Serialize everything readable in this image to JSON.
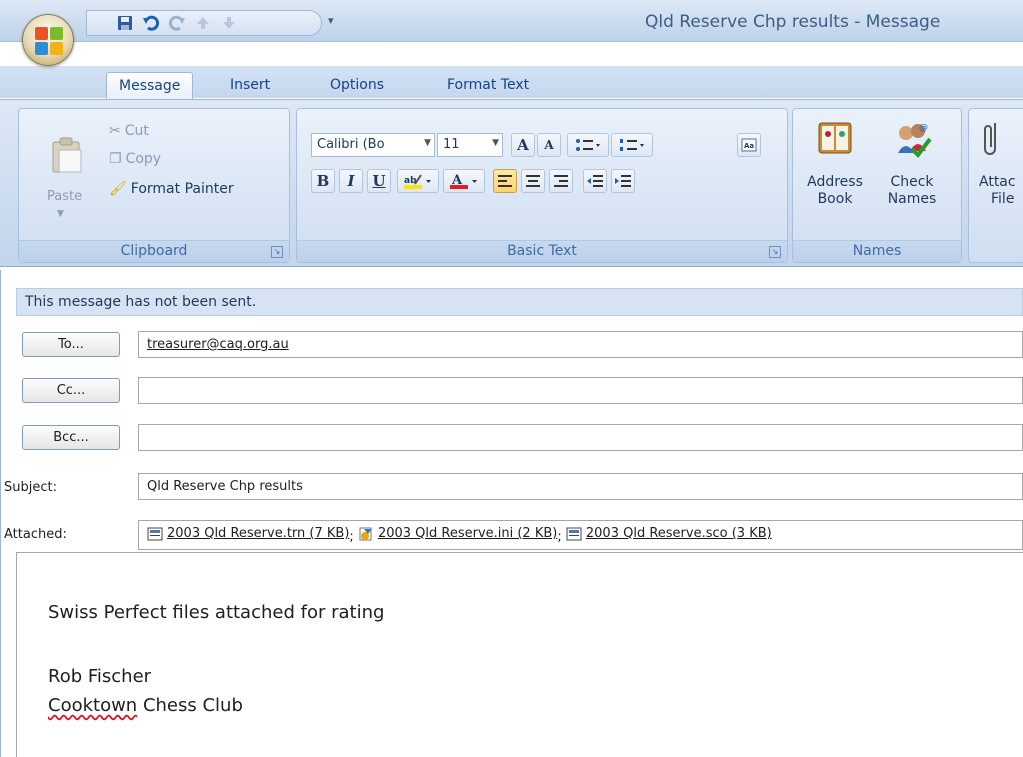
{
  "window": {
    "title": "Qld Reserve Chp results - Message"
  },
  "quick_access": {
    "icons": [
      "save-icon",
      "undo-icon",
      "redo-icon",
      "up-icon",
      "down-icon"
    ]
  },
  "tabs": [
    {
      "label": "Message",
      "active": true
    },
    {
      "label": "Insert"
    },
    {
      "label": "Options"
    },
    {
      "label": "Format Text"
    }
  ],
  "clipboard": {
    "paste": "Paste",
    "cut": "Cut",
    "copy": "Copy",
    "format_painter": "Format Painter",
    "group": "Clipboard"
  },
  "basic_text": {
    "font": "Calibri (Bo",
    "size": "11",
    "bold": "B",
    "italic": "I",
    "underline": "U",
    "group": "Basic Text"
  },
  "names": {
    "address_book": [
      "Address",
      "Book"
    ],
    "check_names": [
      "Check",
      "Names"
    ],
    "group": "Names"
  },
  "include": {
    "attach_file": [
      "Attac",
      "File"
    ]
  },
  "compose": {
    "infobar": "This message has not been sent.",
    "to_button": "To...",
    "cc_button": "Cc...",
    "bcc_button": "Bcc...",
    "to": "treasurer@caq.org.au",
    "cc": "",
    "bcc": "",
    "subject_label": "Subject:",
    "subject": "Qld Reserve Chp results",
    "attached_label": "Attached:",
    "attachments": [
      "2003 Qld Reserve.trn (7 KB)",
      "2003 Qld Reserve.ini (2 KB)",
      "2003 Qld Reserve.sco (3 KB)"
    ],
    "separator": ";",
    "body": {
      "line1": "Swiss Perfect files attached for rating",
      "signature_name": "Rob Fischer",
      "signature_club_word": "Cooktown",
      "signature_club_rest": " Chess Club"
    }
  },
  "colors": {
    "ribbon_blue": "#c2d5ec",
    "text_blue": "#15428b",
    "highlight_yellow": "#ffd36b",
    "font_red": "#e0201b"
  }
}
